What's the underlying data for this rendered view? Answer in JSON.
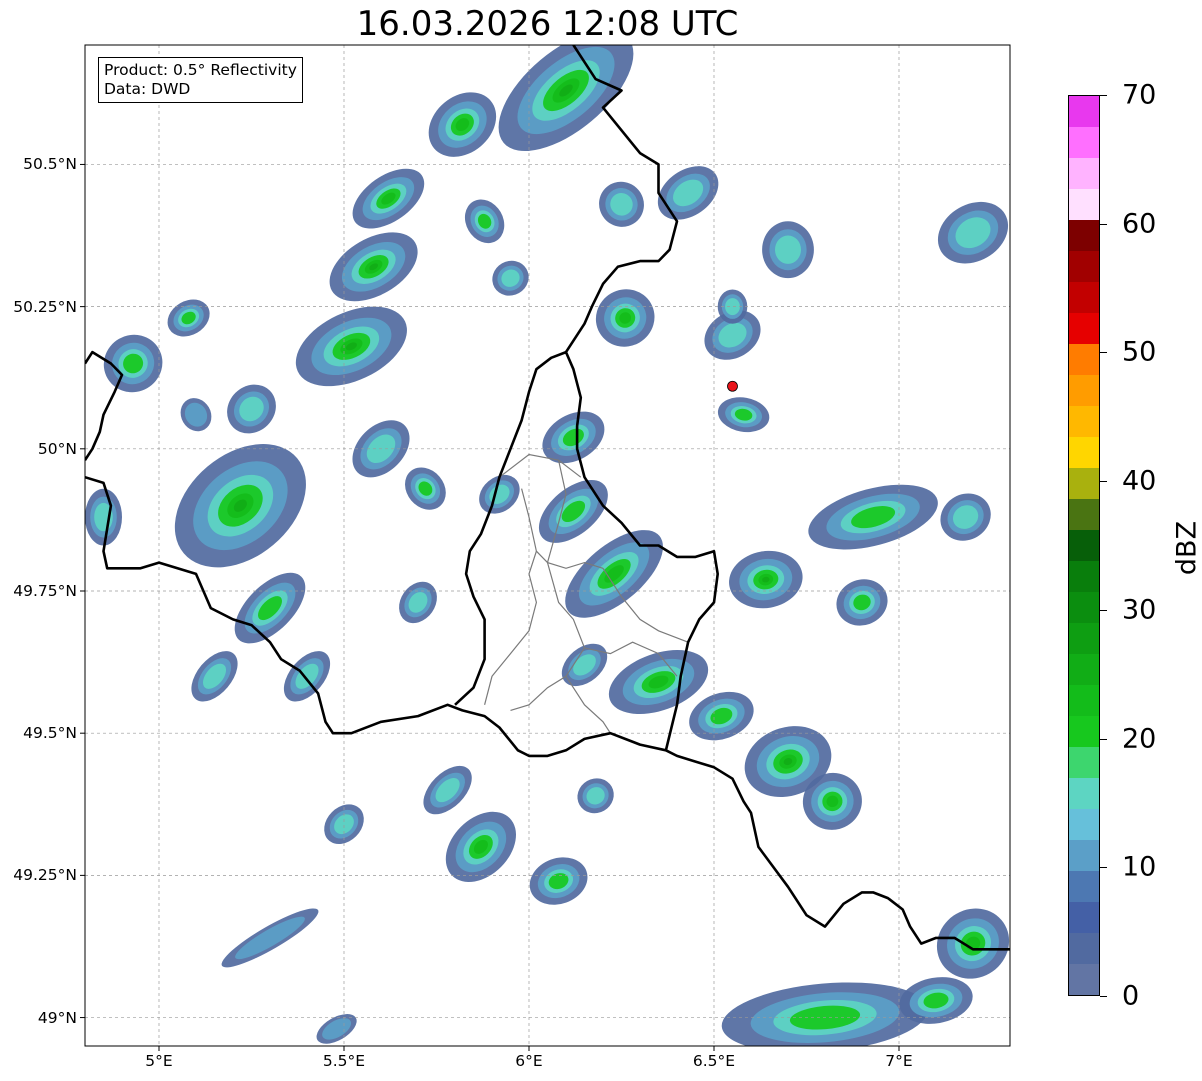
{
  "title": "16.03.2026 12:08 UTC",
  "info": {
    "product": "Product: 0.5° Reflectivity",
    "data": "Data: DWD"
  },
  "map": {
    "lon_range": [
      4.8,
      7.3
    ],
    "lat_range": [
      48.95,
      50.71
    ],
    "x_ticks": [
      {
        "value": 5.0,
        "label": "5°E"
      },
      {
        "value": 5.5,
        "label": "5.5°E"
      },
      {
        "value": 6.0,
        "label": "6°E"
      },
      {
        "value": 6.5,
        "label": "6.5°E"
      },
      {
        "value": 7.0,
        "label": "7°E"
      }
    ],
    "y_ticks": [
      {
        "value": 49.0,
        "label": "49°N"
      },
      {
        "value": 49.25,
        "label": "49.25°N"
      },
      {
        "value": 49.5,
        "label": "49.5°N"
      },
      {
        "value": 49.75,
        "label": "49.75°N"
      },
      {
        "value": 50.0,
        "label": "50°N"
      },
      {
        "value": 50.25,
        "label": "50.25°N"
      },
      {
        "value": 50.5,
        "label": "50.5°N"
      }
    ],
    "grid": true,
    "radar_site": {
      "lon": 6.55,
      "lat": 50.11,
      "color": "#e8141a"
    },
    "borders": [
      [
        [
          4.8,
          50.15
        ],
        [
          4.82,
          50.17
        ],
        [
          4.87,
          50.15
        ],
        [
          4.9,
          50.13
        ],
        [
          4.88,
          50.1
        ],
        [
          4.85,
          50.06
        ],
        [
          4.84,
          50.03
        ],
        [
          4.82,
          50.0
        ],
        [
          4.8,
          49.98
        ]
      ],
      [
        [
          4.8,
          49.95
        ],
        [
          4.85,
          49.94
        ],
        [
          4.87,
          49.9
        ],
        [
          4.86,
          49.86
        ],
        [
          4.85,
          49.82
        ],
        [
          4.86,
          49.79
        ],
        [
          4.9,
          49.79
        ],
        [
          4.95,
          49.79
        ],
        [
          5.0,
          49.8
        ],
        [
          5.05,
          49.79
        ],
        [
          5.1,
          49.78
        ],
        [
          5.14,
          49.72
        ],
        [
          5.2,
          49.7
        ],
        [
          5.25,
          49.69
        ],
        [
          5.3,
          49.66
        ],
        [
          5.33,
          49.63
        ],
        [
          5.38,
          49.61
        ],
        [
          5.43,
          49.57
        ],
        [
          5.45,
          49.52
        ],
        [
          5.47,
          49.5
        ],
        [
          5.52,
          49.5
        ],
        [
          5.6,
          49.52
        ],
        [
          5.7,
          49.53
        ],
        [
          5.78,
          49.55
        ],
        [
          5.82,
          49.54
        ],
        [
          5.88,
          49.53
        ],
        [
          5.92,
          49.51
        ],
        [
          5.97,
          49.47
        ],
        [
          6.0,
          49.46
        ],
        [
          6.05,
          49.46
        ],
        [
          6.1,
          49.47
        ],
        [
          6.15,
          49.49
        ],
        [
          6.22,
          49.5
        ],
        [
          6.3,
          49.48
        ],
        [
          6.37,
          49.47
        ],
        [
          6.4,
          49.46
        ],
        [
          6.45,
          49.45
        ],
        [
          6.5,
          49.44
        ],
        [
          6.55,
          49.42
        ],
        [
          6.58,
          49.38
        ],
        [
          6.6,
          49.36
        ],
        [
          6.62,
          49.3
        ],
        [
          6.7,
          49.23
        ],
        [
          6.75,
          49.18
        ],
        [
          6.8,
          49.16
        ],
        [
          6.85,
          49.2
        ],
        [
          6.9,
          49.22
        ],
        [
          6.93,
          49.22
        ],
        [
          6.97,
          49.21
        ],
        [
          7.01,
          49.19
        ],
        [
          7.03,
          49.16
        ],
        [
          7.06,
          49.13
        ],
        [
          7.1,
          49.14
        ],
        [
          7.15,
          49.14
        ],
        [
          7.2,
          49.12
        ],
        [
          7.25,
          49.12
        ],
        [
          7.3,
          49.12
        ]
      ],
      [
        [
          5.8,
          49.55
        ],
        [
          5.85,
          49.58
        ],
        [
          5.88,
          49.63
        ],
        [
          5.88,
          49.7
        ],
        [
          5.85,
          49.74
        ],
        [
          5.83,
          49.78
        ],
        [
          5.84,
          49.82
        ],
        [
          5.87,
          49.85
        ],
        [
          5.9,
          49.9
        ],
        [
          5.92,
          49.95
        ],
        [
          5.95,
          50.0
        ],
        [
          5.98,
          50.05
        ],
        [
          6.0,
          50.1
        ],
        [
          6.02,
          50.14
        ],
        [
          6.06,
          50.16
        ],
        [
          6.1,
          50.17
        ],
        [
          6.12,
          50.14
        ],
        [
          6.14,
          50.09
        ],
        [
          6.13,
          50.04
        ],
        [
          6.13,
          50.0
        ],
        [
          6.15,
          49.95
        ],
        [
          6.2,
          49.9
        ],
        [
          6.25,
          49.87
        ],
        [
          6.3,
          49.83
        ],
        [
          6.32,
          49.83
        ],
        [
          6.35,
          49.83
        ],
        [
          6.4,
          49.81
        ],
        [
          6.45,
          49.81
        ],
        [
          6.5,
          49.82
        ],
        [
          6.51,
          49.78
        ],
        [
          6.5,
          49.73
        ],
        [
          6.46,
          49.7
        ],
        [
          6.43,
          49.66
        ],
        [
          6.41,
          49.6
        ],
        [
          6.4,
          49.55
        ],
        [
          6.37,
          49.47
        ]
      ],
      [
        [
          6.1,
          50.17
        ],
        [
          6.15,
          50.22
        ],
        [
          6.17,
          50.25
        ],
        [
          6.2,
          50.29
        ],
        [
          6.24,
          50.32
        ],
        [
          6.3,
          50.33
        ],
        [
          6.35,
          50.33
        ],
        [
          6.38,
          50.35
        ],
        [
          6.4,
          50.4
        ],
        [
          6.35,
          50.45
        ],
        [
          6.35,
          50.5
        ],
        [
          6.3,
          50.52
        ],
        [
          6.25,
          50.56
        ],
        [
          6.2,
          50.6
        ],
        [
          6.25,
          50.63
        ],
        [
          6.18,
          50.65
        ],
        [
          6.15,
          50.68
        ],
        [
          6.12,
          50.71
        ]
      ]
    ],
    "districts": [
      [
        [
          5.92,
          49.95
        ],
        [
          6.0,
          49.99
        ],
        [
          6.08,
          49.98
        ],
        [
          6.14,
          49.95
        ]
      ],
      [
        [
          5.98,
          49.93
        ],
        [
          6.0,
          49.88
        ],
        [
          6.02,
          49.82
        ],
        [
          6.05,
          49.8
        ],
        [
          6.1,
          49.79
        ],
        [
          6.15,
          49.8
        ],
        [
          6.2,
          49.79
        ]
      ],
      [
        [
          6.02,
          49.82
        ],
        [
          6.0,
          49.78
        ],
        [
          6.02,
          49.73
        ],
        [
          6.0,
          49.68
        ],
        [
          5.95,
          49.64
        ],
        [
          5.9,
          49.6
        ],
        [
          5.88,
          49.55
        ]
      ],
      [
        [
          6.05,
          49.8
        ],
        [
          6.08,
          49.73
        ],
        [
          6.12,
          49.7
        ],
        [
          6.15,
          49.65
        ],
        [
          6.1,
          49.6
        ],
        [
          6.05,
          49.58
        ],
        [
          6.0,
          49.55
        ],
        [
          5.95,
          49.54
        ]
      ],
      [
        [
          6.15,
          49.65
        ],
        [
          6.22,
          49.64
        ],
        [
          6.28,
          49.66
        ],
        [
          6.35,
          49.64
        ],
        [
          6.4,
          49.6
        ]
      ],
      [
        [
          6.1,
          49.6
        ],
        [
          6.15,
          49.55
        ],
        [
          6.2,
          49.52
        ],
        [
          6.22,
          49.5
        ]
      ],
      [
        [
          6.2,
          49.79
        ],
        [
          6.25,
          49.74
        ],
        [
          6.3,
          49.7
        ],
        [
          6.35,
          49.68
        ],
        [
          6.43,
          49.66
        ]
      ],
      [
        [
          6.08,
          49.98
        ],
        [
          6.1,
          49.92
        ],
        [
          6.08,
          49.87
        ],
        [
          6.05,
          49.8
        ]
      ]
    ]
  },
  "colorbar": {
    "label": "dBZ",
    "min": 0,
    "max": 70,
    "step": 2.5,
    "ticks": [
      0,
      10,
      20,
      30,
      40,
      50,
      60,
      70
    ],
    "tick_labels": [
      "0",
      "10",
      "20",
      "30",
      "40",
      "50",
      "60",
      "70"
    ],
    "colors": [
      "#6275a4",
      "#516aa0",
      "#4460a6",
      "#4d78b2",
      "#5b9fc8",
      "#66c0da",
      "#5dd5c2",
      "#3dd66e",
      "#17c81e",
      "#13bc1a",
      "#11ad16",
      "#0e9e12",
      "#0b8e0f",
      "#097e0c",
      "#075f09",
      "#4a7412",
      "#a9b10e",
      "#ffd600",
      "#ffb800",
      "#ff9c00",
      "#ff7c00",
      "#e60000",
      "#c20000",
      "#a10000",
      "#7d0000",
      "#ffe0ff",
      "#ffb3ff",
      "#ff6fff",
      "#e838ee"
    ]
  },
  "echoes": [
    {
      "lon": 6.1,
      "lat": 50.63,
      "a": 0.22,
      "b": 0.07,
      "rot": -40,
      "peak": 12
    },
    {
      "lon": 5.82,
      "lat": 50.57,
      "a": 0.1,
      "b": 0.05,
      "rot": -40,
      "peak": 9
    },
    {
      "lon": 5.62,
      "lat": 50.44,
      "a": 0.11,
      "b": 0.04,
      "rot": -35,
      "peak": 9
    },
    {
      "lon": 5.58,
      "lat": 50.32,
      "a": 0.13,
      "b": 0.05,
      "rot": -30,
      "peak": 11
    },
    {
      "lon": 5.52,
      "lat": 50.18,
      "a": 0.16,
      "b": 0.06,
      "rot": -25,
      "peak": 10
    },
    {
      "lon": 5.88,
      "lat": 50.4,
      "a": 0.05,
      "b": 0.04,
      "rot": -30,
      "peak": 8
    },
    {
      "lon": 5.95,
      "lat": 50.3,
      "a": 0.05,
      "b": 0.03,
      "rot": -30,
      "peak": 6
    },
    {
      "lon": 6.25,
      "lat": 50.43,
      "a": 0.06,
      "b": 0.04,
      "rot": -40,
      "peak": 7
    },
    {
      "lon": 6.43,
      "lat": 50.45,
      "a": 0.09,
      "b": 0.04,
      "rot": -35,
      "peak": 6
    },
    {
      "lon": 6.7,
      "lat": 50.35,
      "a": 0.07,
      "b": 0.05,
      "rot": 0,
      "peak": 7
    },
    {
      "lon": 6.26,
      "lat": 50.23,
      "a": 0.08,
      "b": 0.05,
      "rot": -30,
      "peak": 9
    },
    {
      "lon": 6.55,
      "lat": 50.2,
      "a": 0.08,
      "b": 0.04,
      "rot": -30,
      "peak": 7
    },
    {
      "lon": 6.58,
      "lat": 50.06,
      "a": 0.07,
      "b": 0.03,
      "rot": 10,
      "peak": 8
    },
    {
      "lon": 5.08,
      "lat": 50.23,
      "a": 0.06,
      "b": 0.03,
      "rot": -30,
      "peak": 8
    },
    {
      "lon": 4.93,
      "lat": 50.15,
      "a": 0.08,
      "b": 0.05,
      "rot": -30,
      "peak": 8
    },
    {
      "lon": 5.25,
      "lat": 50.07,
      "a": 0.07,
      "b": 0.04,
      "rot": -45,
      "peak": 7
    },
    {
      "lon": 5.22,
      "lat": 49.9,
      "a": 0.2,
      "b": 0.09,
      "rot": -40,
      "peak": 10
    },
    {
      "lon": 5.3,
      "lat": 49.72,
      "a": 0.12,
      "b": 0.04,
      "rot": -45,
      "peak": 8
    },
    {
      "lon": 5.15,
      "lat": 49.6,
      "a": 0.08,
      "b": 0.03,
      "rot": -50,
      "peak": 6
    },
    {
      "lon": 5.4,
      "lat": 49.6,
      "a": 0.08,
      "b": 0.03,
      "rot": -50,
      "peak": 6
    },
    {
      "lon": 4.85,
      "lat": 49.88,
      "a": 0.05,
      "b": 0.05,
      "rot": 0,
      "peak": 7
    },
    {
      "lon": 5.6,
      "lat": 50.0,
      "a": 0.09,
      "b": 0.04,
      "rot": -45,
      "peak": 6
    },
    {
      "lon": 5.72,
      "lat": 49.93,
      "a": 0.05,
      "b": 0.04,
      "rot": -40,
      "peak": 8
    },
    {
      "lon": 5.7,
      "lat": 49.73,
      "a": 0.06,
      "b": 0.03,
      "rot": -55,
      "peak": 7
    },
    {
      "lon": 6.12,
      "lat": 50.02,
      "a": 0.09,
      "b": 0.04,
      "rot": -30,
      "peak": 8
    },
    {
      "lon": 6.12,
      "lat": 49.89,
      "a": 0.11,
      "b": 0.04,
      "rot": -40,
      "peak": 8
    },
    {
      "lon": 5.92,
      "lat": 49.92,
      "a": 0.06,
      "b": 0.03,
      "rot": -40,
      "peak": 6
    },
    {
      "lon": 6.23,
      "lat": 49.78,
      "a": 0.16,
      "b": 0.05,
      "rot": -40,
      "peak": 9
    },
    {
      "lon": 6.35,
      "lat": 49.59,
      "a": 0.14,
      "b": 0.05,
      "rot": -20,
      "peak": 9
    },
    {
      "lon": 6.52,
      "lat": 49.53,
      "a": 0.09,
      "b": 0.04,
      "rot": -20,
      "peak": 8
    },
    {
      "lon": 6.15,
      "lat": 49.62,
      "a": 0.07,
      "b": 0.03,
      "rot": -40,
      "peak": 6
    },
    {
      "lon": 6.7,
      "lat": 49.45,
      "a": 0.12,
      "b": 0.06,
      "rot": -20,
      "peak": 10
    },
    {
      "lon": 6.82,
      "lat": 49.38,
      "a": 0.08,
      "b": 0.05,
      "rot": -15,
      "peak": 9
    },
    {
      "lon": 6.64,
      "lat": 49.77,
      "a": 0.1,
      "b": 0.05,
      "rot": -10,
      "peak": 10
    },
    {
      "lon": 6.9,
      "lat": 49.73,
      "a": 0.07,
      "b": 0.04,
      "rot": -20,
      "peak": 8
    },
    {
      "lon": 6.93,
      "lat": 49.88,
      "a": 0.18,
      "b": 0.05,
      "rot": -15,
      "peak": 8
    },
    {
      "lon": 7.18,
      "lat": 49.88,
      "a": 0.07,
      "b": 0.04,
      "rot": -30,
      "peak": 6
    },
    {
      "lon": 7.2,
      "lat": 49.13,
      "a": 0.1,
      "b": 0.06,
      "rot": -35,
      "peak": 9
    },
    {
      "lon": 7.2,
      "lat": 50.38,
      "a": 0.1,
      "b": 0.05,
      "rot": -30,
      "peak": 7
    },
    {
      "lon": 6.8,
      "lat": 49.0,
      "a": 0.28,
      "b": 0.06,
      "rot": -5,
      "peak": 8
    },
    {
      "lon": 7.1,
      "lat": 49.03,
      "a": 0.1,
      "b": 0.04,
      "rot": -10,
      "peak": 8
    },
    {
      "lon": 5.87,
      "lat": 49.3,
      "a": 0.11,
      "b": 0.05,
      "rot": -45,
      "peak": 9
    },
    {
      "lon": 6.08,
      "lat": 49.24,
      "a": 0.08,
      "b": 0.04,
      "rot": -20,
      "peak": 8
    },
    {
      "lon": 6.18,
      "lat": 49.39,
      "a": 0.05,
      "b": 0.03,
      "rot": -30,
      "peak": 7
    },
    {
      "lon": 5.78,
      "lat": 49.4,
      "a": 0.08,
      "b": 0.03,
      "rot": -45,
      "peak": 6
    },
    {
      "lon": 5.5,
      "lat": 49.34,
      "a": 0.06,
      "b": 0.03,
      "rot": -45,
      "peak": 6
    },
    {
      "lon": 5.3,
      "lat": 49.14,
      "a": 0.15,
      "b": 0.02,
      "rot": -30,
      "peak": 5
    },
    {
      "lon": 5.48,
      "lat": 48.98,
      "a": 0.06,
      "b": 0.02,
      "rot": -30,
      "peak": 5
    },
    {
      "lon": 5.1,
      "lat": 50.06,
      "a": 0.04,
      "b": 0.03,
      "rot": -30,
      "peak": 5
    },
    {
      "lon": 6.55,
      "lat": 50.25,
      "a": 0.04,
      "b": 0.03,
      "rot": 0,
      "peak": 6
    }
  ]
}
